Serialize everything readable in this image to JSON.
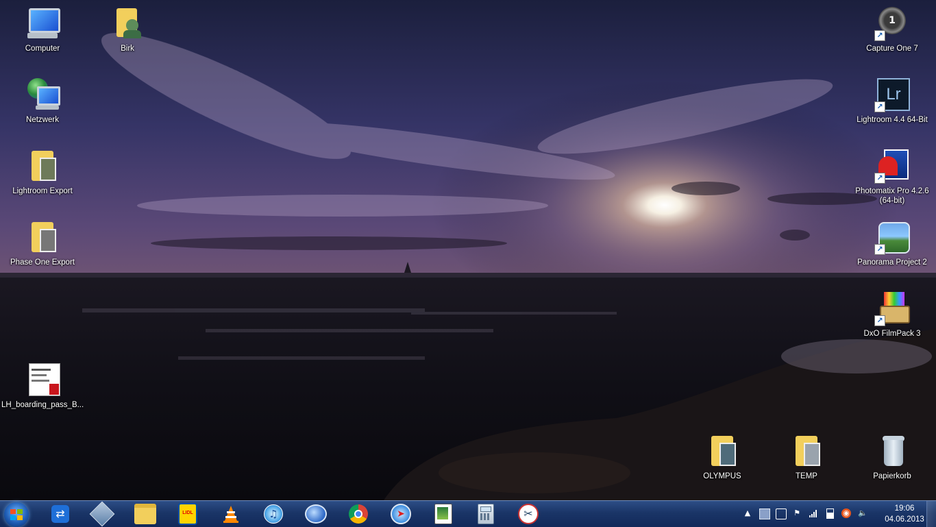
{
  "desktop": {
    "icons": [
      {
        "label": "Computer",
        "icon": "computer-icon"
      },
      {
        "label": "Birk",
        "icon": "user-folder-icon"
      },
      {
        "label": "Netzwerk",
        "icon": "network-icon"
      },
      {
        "label": "Lightroom Export",
        "icon": "folder-icon"
      },
      {
        "label": "Phase One Export",
        "icon": "folder-icon"
      },
      {
        "label": "LH_boarding_pass_B...",
        "icon": "pdf-icon"
      },
      {
        "label": "Capture One 7",
        "icon": "capture-one-icon"
      },
      {
        "label": "Lightroom 4.4 64-Bit",
        "icon": "lightroom-icon"
      },
      {
        "label": "Photomatix Pro 4.2.6\n(64-bit)",
        "icon": "photomatix-icon"
      },
      {
        "label": "Panorama Project 2",
        "icon": "panorama-icon"
      },
      {
        "label": "DxO FilmPack 3",
        "icon": "dxo-filmpack-icon"
      },
      {
        "label": "OLYMPUS",
        "icon": "folder-icon"
      },
      {
        "label": "TEMP",
        "icon": "folder-icon"
      },
      {
        "label": "Papierkorb",
        "icon": "recycle-bin-icon"
      }
    ],
    "lightroom_badge": "Lr"
  },
  "taskbar": {
    "pinned": [
      "teamviewer-icon",
      "virtualbox-icon",
      "explorer-icon",
      "lidl-mobile-icon",
      "vlc-icon",
      "itunes-icon",
      "thunderbird-icon",
      "chrome-icon",
      "safari-icon",
      "solitaire-icon",
      "calculator-icon",
      "snipping-tool-icon"
    ],
    "lidl_text": "LIDL",
    "tray_icons": [
      "show-hidden-icon",
      "network-status-icon",
      "sync-icon",
      "action-center-flag-icon",
      "signal-bars-icon",
      "battery-icon",
      "update-icon",
      "volume-icon"
    ],
    "clock": {
      "time": "19:06",
      "date": "04.06.2013"
    }
  },
  "colors": {
    "taskbar_top": "#2d4e86",
    "taskbar_bottom": "#12295a",
    "folder_yellow": "#f2cf5c"
  }
}
